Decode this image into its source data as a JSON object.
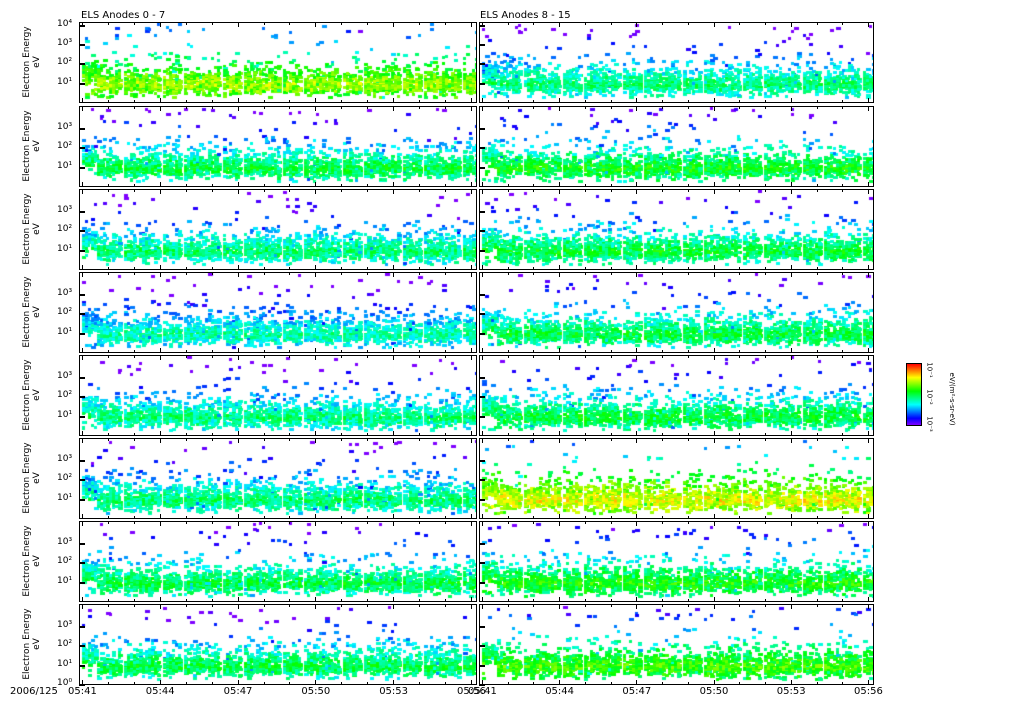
{
  "chart_data": {
    "type": "heatmap",
    "subtype": "spectrogram-grid",
    "column_titles": [
      "ELS Anodes 0 - 7",
      "ELS Anodes 8 - 15"
    ],
    "ylabel": "Electron Energy",
    "yunit": "eV",
    "yscale": "log",
    "ylim": [
      1,
      10000
    ],
    "date_label": "2006/125",
    "xticks": [
      "05:41",
      "05:44",
      "05:47",
      "05:50",
      "05:53",
      "05:56"
    ],
    "xtick_left_last": "05:56",
    "xlim_minutes": [
      0,
      15
    ],
    "ytick_labels_top_row": [
      "10⁴",
      "10³",
      "10²",
      "10¹"
    ],
    "ytick_labels_middle_rows": [
      "10³",
      "10²",
      "10¹"
    ],
    "ytick_labels_bottom_row": [
      "10³",
      "10²",
      "10¹",
      "10⁰"
    ],
    "peak_energy_eV": 10,
    "panels": [
      {
        "anode": 0,
        "column": "left",
        "intensity": 0.55
      },
      {
        "anode": 8,
        "column": "right",
        "intensity": 0.32
      },
      {
        "anode": 1,
        "column": "left",
        "intensity": 0.36
      },
      {
        "anode": 9,
        "column": "right",
        "intensity": 0.4
      },
      {
        "anode": 2,
        "column": "left",
        "intensity": 0.32
      },
      {
        "anode": 10,
        "column": "right",
        "intensity": 0.37
      },
      {
        "anode": 3,
        "column": "left",
        "intensity": 0.27
      },
      {
        "anode": 11,
        "column": "right",
        "intensity": 0.36
      },
      {
        "anode": 4,
        "column": "left",
        "intensity": 0.31
      },
      {
        "anode": 12,
        "column": "right",
        "intensity": 0.37
      },
      {
        "anode": 5,
        "column": "left",
        "intensity": 0.32
      },
      {
        "anode": 13,
        "column": "right",
        "intensity": 0.62
      },
      {
        "anode": 6,
        "column": "left",
        "intensity": 0.36
      },
      {
        "anode": 14,
        "column": "right",
        "intensity": 0.42
      },
      {
        "anode": 7,
        "column": "left",
        "intensity": 0.36
      },
      {
        "anode": 15,
        "column": "right",
        "intensity": 0.46
      }
    ],
    "colorbar": {
      "scale": "log",
      "tick_labels": [
        "10⁻¹",
        "10⁻²",
        "10⁻³"
      ],
      "label": "eV/(m²-s-sr-eV)",
      "colormap": "rainbow"
    }
  }
}
